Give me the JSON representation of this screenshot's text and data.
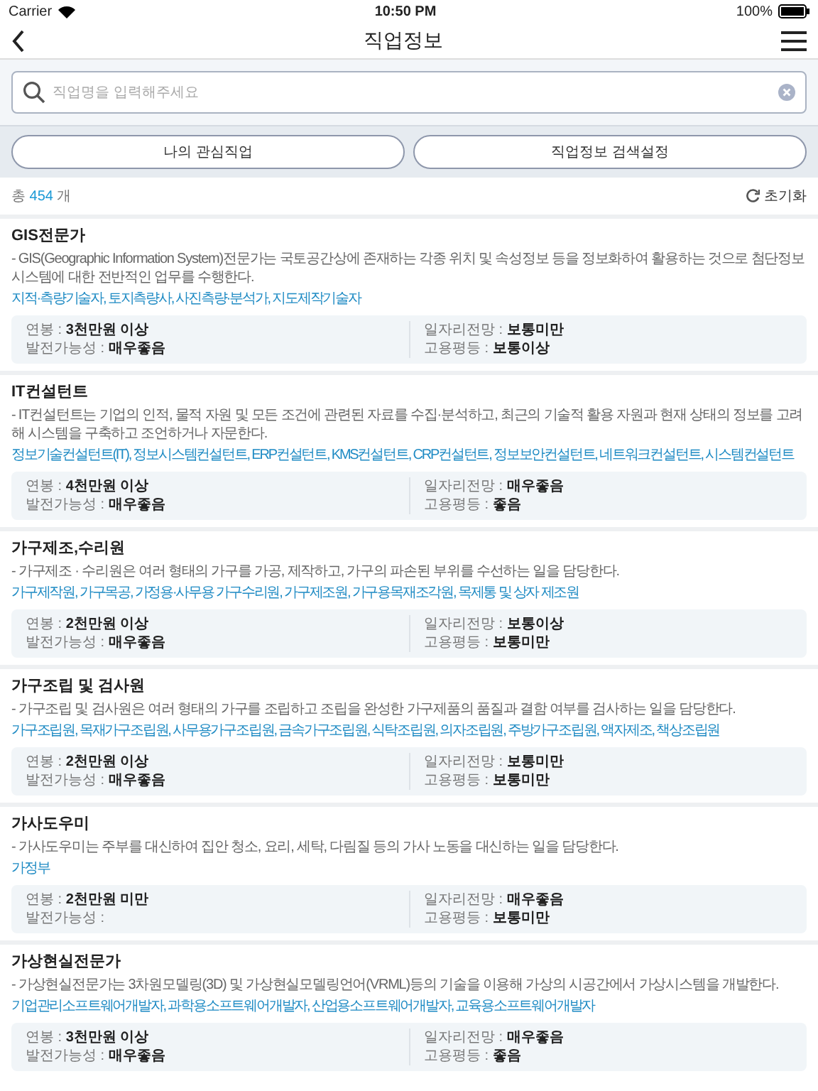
{
  "status_bar": {
    "carrier": "Carrier",
    "time": "10:50 PM",
    "battery": "100%"
  },
  "nav": {
    "title": "직업정보"
  },
  "search": {
    "placeholder": "직업명을 입력해주세요"
  },
  "buttons": [
    "나의 관심직업",
    "직업정보 검색설정"
  ],
  "result": {
    "prefix": "총",
    "count": "454",
    "suffix": "개",
    "reset": "초기화"
  },
  "jobs": [
    {
      "title": "GIS전문가",
      "description": "- GIS(Geographic Information System)전문가는 국토공간상에 존재하는 각종 위치 및 속성정보 등을 정보화하여 활용하는 것으로 첨단정보시스템에 대한 전반적인 업무를 수행한다.",
      "related": "지적·측량기술자, 토지측량사, 사진측량·분석가, 지도제작기술자",
      "info": [
        {
          "label": "연봉 :",
          "value": "3천만원 이상"
        },
        {
          "label": "일자리전망 :",
          "value": "보통미만"
        },
        {
          "label": "발전가능성 :",
          "value": "매우좋음"
        },
        {
          "label": "고용평등 :",
          "value": "보통이상"
        }
      ]
    },
    {
      "title": "IT컨설턴트",
      "description": "- IT컨설턴트는 기업의 인적, 물적 자원 및 모든 조건에 관련된 자료를 수집·분석하고, 최근의 기술적 활용 자원과 현재 상태의 정보를 고려해 시스템을 구축하고 조언하거나 자문한다.",
      "related": "정보기술컨설턴트(IT), 정보시스템컨설턴트, ERP컨설턴트, KMS컨설턴트, CRP컨설턴트, 정보보안컨설턴트, 네트워크컨설턴트, 시스템컨설턴트",
      "info": [
        {
          "label": "연봉 :",
          "value": "4천만원 이상"
        },
        {
          "label": "일자리전망 :",
          "value": "매우좋음"
        },
        {
          "label": "발전가능성 :",
          "value": "매우좋음"
        },
        {
          "label": "고용평등 :",
          "value": "좋음"
        }
      ]
    },
    {
      "title": "가구제조,수리원",
      "description": "- 가구제조 · 수리원은 여러 형태의 가구를 가공, 제작하고, 가구의 파손된 부위를 수선하는 일을 담당한다.",
      "related": "가구제작원, 가구목공, 가정용·사무용 가구수리원, 가구제조원, 가구용목재조각원, 목제통 및 상자 제조원",
      "info": [
        {
          "label": "연봉 :",
          "value": "2천만원 이상"
        },
        {
          "label": "일자리전망 :",
          "value": "보통이상"
        },
        {
          "label": "발전가능성 :",
          "value": "매우좋음"
        },
        {
          "label": "고용평등 :",
          "value": "보통미만"
        }
      ]
    },
    {
      "title": "가구조립 및 검사원",
      "description": "- 가구조립 및 검사원은 여러 형태의 가구를 조립하고 조립을 완성한 가구제품의 품질과 결함 여부를 검사하는 일을 담당한다.",
      "related": "가구조립원, 목재가구조립원, 사무용가구조립원, 금속가구조립원, 식탁조립원, 의자조립원, 주방가구조립원, 액자제조, 책상조립원",
      "info": [
        {
          "label": "연봉 :",
          "value": "2천만원 이상"
        },
        {
          "label": "일자리전망 :",
          "value": "보통미만"
        },
        {
          "label": "발전가능성 :",
          "value": "매우좋음"
        },
        {
          "label": "고용평등 :",
          "value": "보통미만"
        }
      ]
    },
    {
      "title": "가사도우미",
      "description": "- 가사도우미는 주부를 대신하여 집안 청소, 요리, 세탁, 다림질 등의 가사 노동을 대신하는 일을 담당한다.",
      "related": "가정부",
      "info": [
        {
          "label": "연봉 :",
          "value": "2천만원 미만"
        },
        {
          "label": "일자리전망 :",
          "value": "매우좋음"
        },
        {
          "label": "발전가능성 :"
        },
        {
          "label": "고용평등 :",
          "value": "보통미만"
        }
      ]
    },
    {
      "title": "가상현실전문가",
      "description": "- 가상현실전문가는 3차원모델링(3D) 및 가상현실모델링언어(VRML)등의 기술을 이용해 가상의 시공간에서 가상시스템을 개발한다.",
      "related": "기업관리소프트웨어개발자, 과학용소프트웨어개발자, 산업용소프트웨어개발자, 교육용소프트웨어개발자",
      "info": [
        {
          "label": "연봉 :",
          "value": "3천만원 이상"
        },
        {
          "label": "일자리전망 :",
          "value": "매우좋음"
        },
        {
          "label": "발전가능성 :",
          "value": "매우좋음"
        },
        {
          "label": "고용평등 :",
          "value": "좋음"
        }
      ]
    }
  ]
}
